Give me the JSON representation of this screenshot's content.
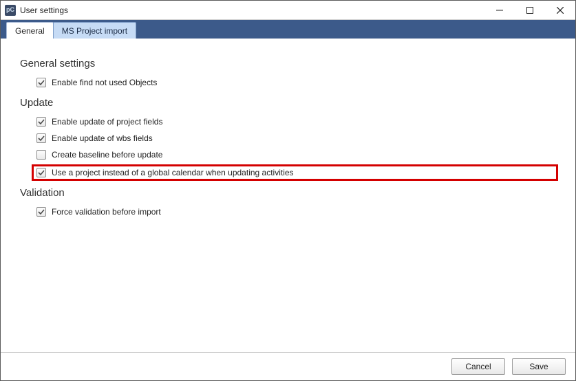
{
  "window": {
    "title": "User settings"
  },
  "tabs": {
    "general": "General",
    "msproject": "MS Project import"
  },
  "sections": {
    "general": "General settings",
    "update": "Update",
    "validation": "Validation"
  },
  "options": {
    "enableFindNotUsed": {
      "label": "Enable find not used Objects",
      "checked": true
    },
    "enableUpdateProject": {
      "label": "Enable update of project fields",
      "checked": true
    },
    "enableUpdateWbs": {
      "label": "Enable update of wbs fields",
      "checked": true
    },
    "createBaseline": {
      "label": "Create baseline before update",
      "checked": false
    },
    "useProjectCalendar": {
      "label": "Use a project instead of a global calendar when updating activities",
      "checked": true,
      "highlighted": true
    },
    "forceValidation": {
      "label": "Force validation before import",
      "checked": true
    }
  },
  "buttons": {
    "cancel": "Cancel",
    "save": "Save"
  }
}
